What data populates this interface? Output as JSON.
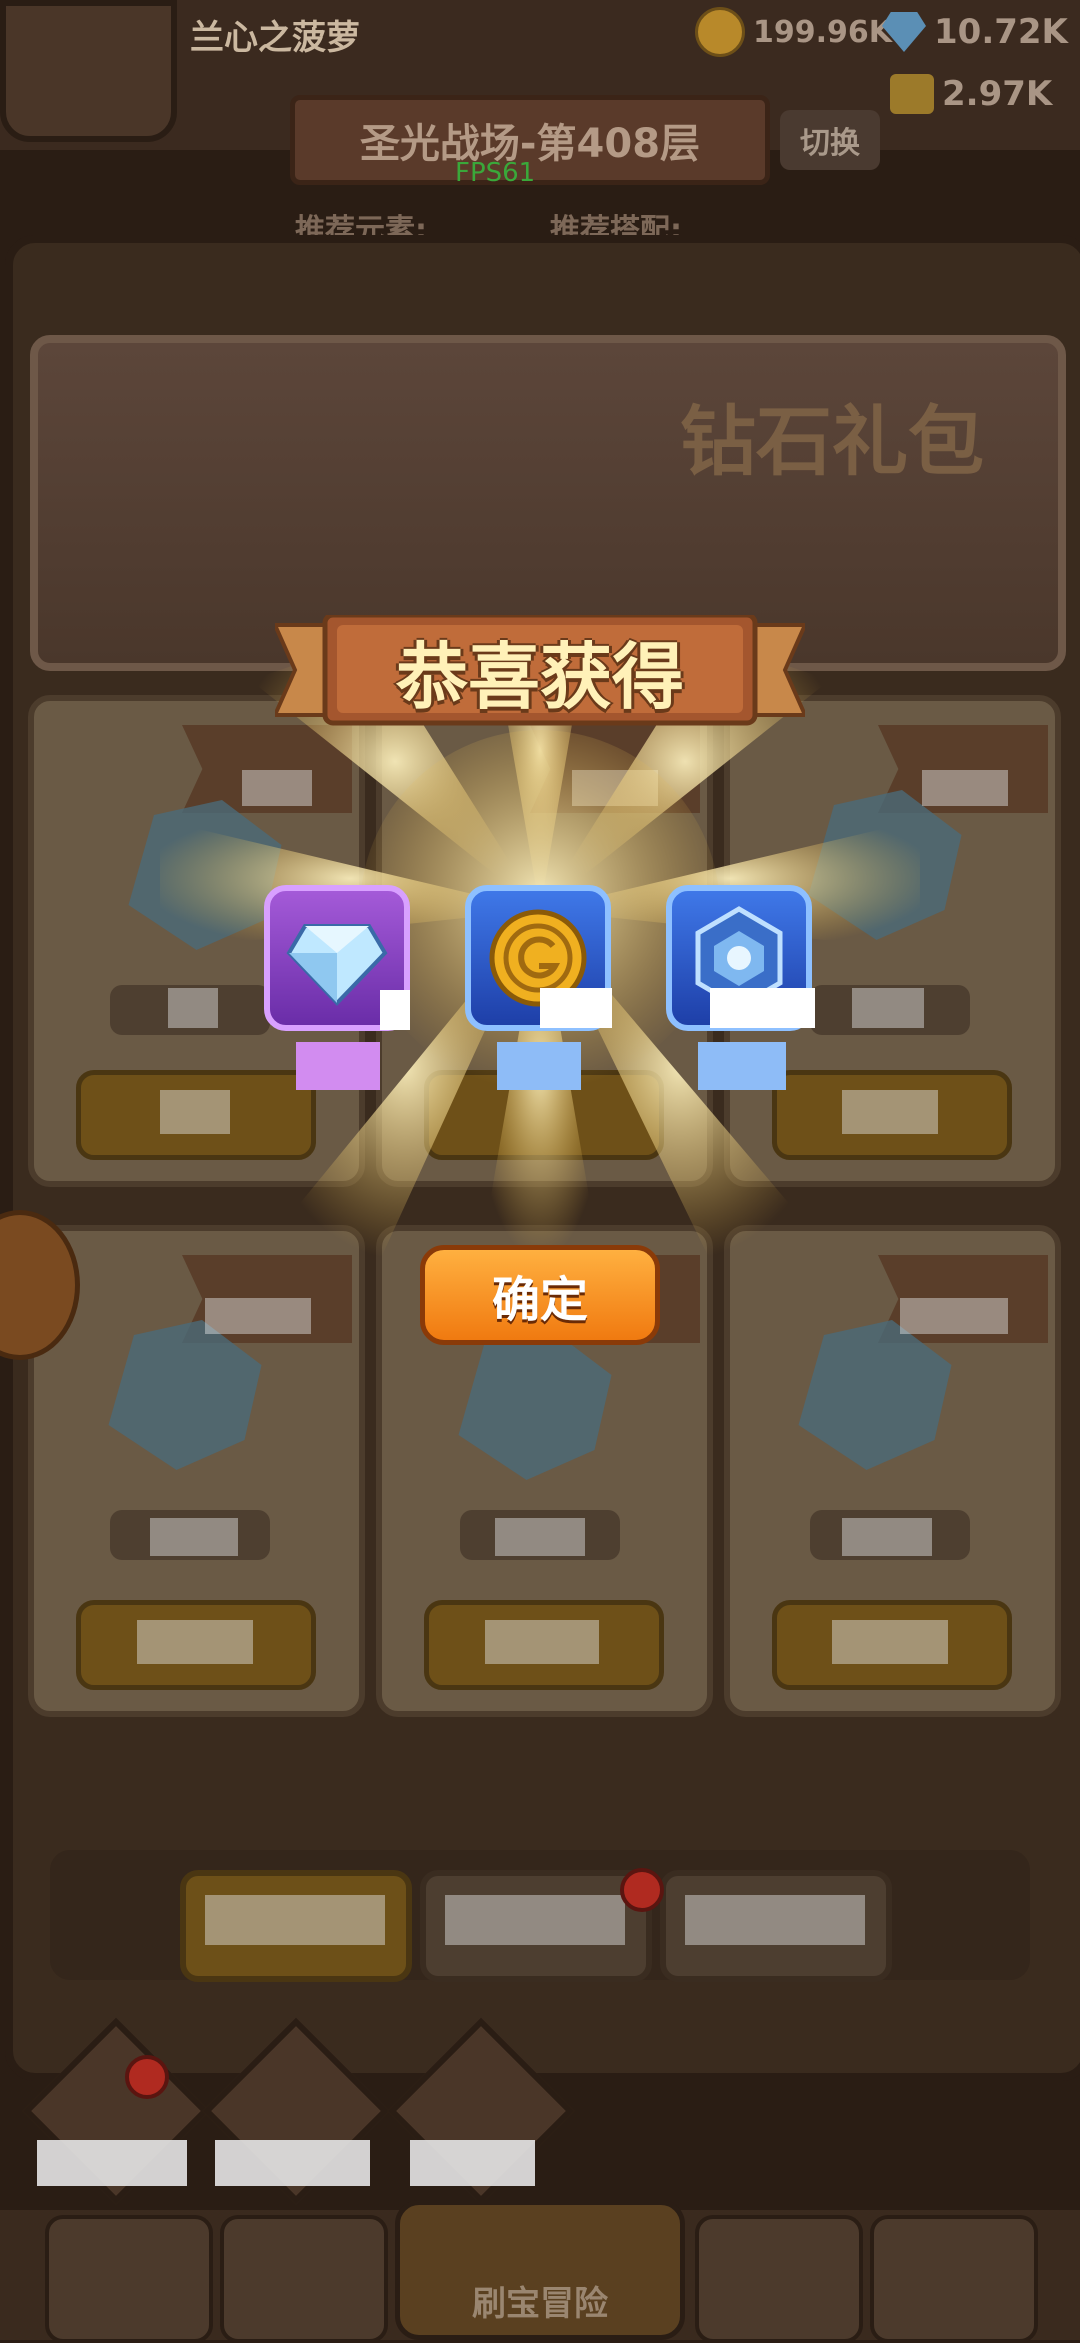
{
  "header": {
    "player_name": "兰心之菠萝",
    "coins": "199.96K",
    "gems": "10.72K",
    "gold": "2.97K",
    "stage_title": "圣光战场-第408层",
    "switch_label": "切换",
    "fps": "FPS61",
    "recommend_element": "推荐元素:",
    "recommend_config": "推荐搭配:"
  },
  "store": {
    "banner_title": "钻石礼包",
    "cards": [
      {
        "icon": "single-gem-icon"
      },
      {
        "icon": "gem-icon"
      },
      {
        "icon": "gem-pile-icon"
      },
      {
        "icon": "gem-pile-icon"
      },
      {
        "icon": "gem-heap-icon"
      },
      {
        "icon": "gem-heap-icon"
      }
    ],
    "tabs": [
      {
        "state": "active"
      },
      {
        "state": "inactive",
        "badge": true
      },
      {
        "state": "inactive"
      }
    ]
  },
  "bottom_nav": {
    "center_label": "刷宝冒险"
  },
  "reward_popup": {
    "title": "恭喜获得",
    "confirm_label": "确定",
    "items": [
      {
        "icon": "diamond-icon",
        "rarity_color": "#d28cf0"
      },
      {
        "icon": "gold-coin-icon",
        "rarity_color": "#8ebcf7"
      },
      {
        "icon": "blue-gem-crest-icon",
        "rarity_color": "#8ebcf7"
      }
    ]
  },
  "colors": {
    "accent_orange": "#f58a1f",
    "title_gold": "#fff1b8"
  }
}
